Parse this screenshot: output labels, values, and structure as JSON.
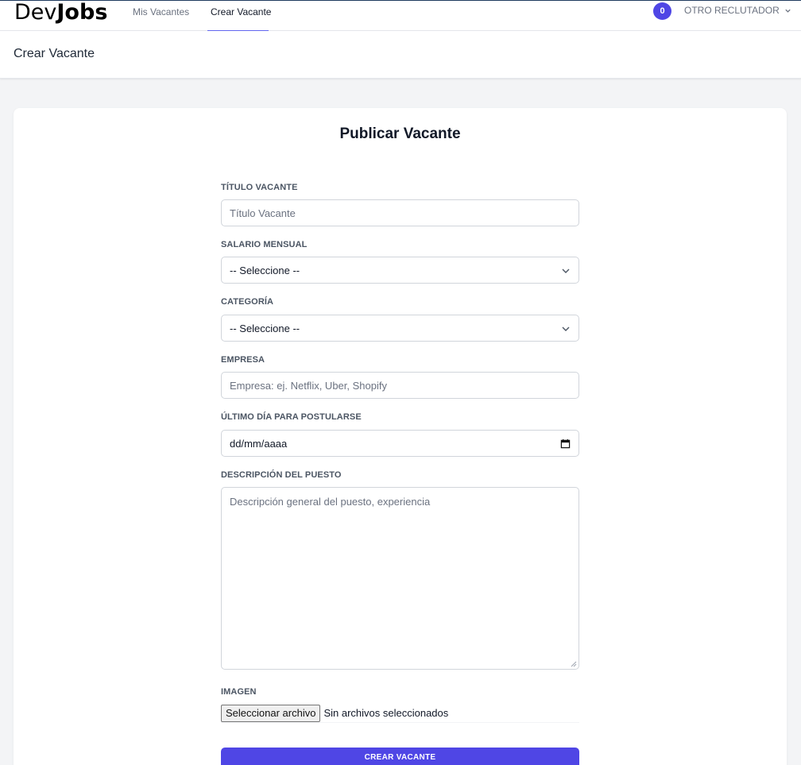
{
  "nav": {
    "logo_light": "Dev",
    "logo_bold": "Jobs",
    "links": [
      "Mis Vacantes",
      "Crear Vacante"
    ],
    "notifications_count": "0",
    "user_name": "OTRO RECLUTADOR"
  },
  "header": {
    "title": "Crear Vacante"
  },
  "form": {
    "title": "Publicar Vacante",
    "titulo_label": "TÍTULO VACANTE",
    "titulo_placeholder": "Título Vacante",
    "salario_label": "SALARIO MENSUAL",
    "salario_value": "-- Seleccione --",
    "categoria_label": "CATEGORÍA",
    "categoria_value": "-- Seleccione --",
    "empresa_label": "EMPRESA",
    "empresa_placeholder": "Empresa: ej. Netflix, Uber, Shopify",
    "fecha_label": "ÚLTIMO DÍA PARA POSTULARSE",
    "fecha_value": "dd/mm/aaaa",
    "descripcion_label": "DESCRIPCIÓN DEL PUESTO",
    "descripcion_placeholder": "Descripción general del puesto, experiencia",
    "imagen_label": "IMAGEN",
    "file_button": "Seleccionar archivo",
    "file_status": "Sin archivos seleccionados",
    "submit_label": "CREAR VACANTE"
  },
  "colors": {
    "accent": "#4f46e5",
    "nav_underline": "#6366f1"
  }
}
